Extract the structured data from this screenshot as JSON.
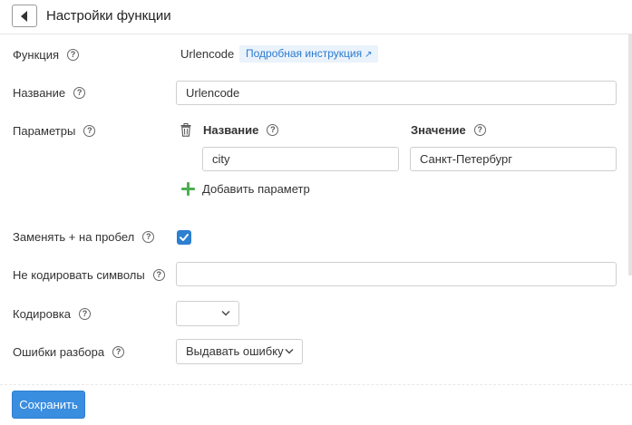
{
  "header": {
    "title": "Настройки функции",
    "back_icon": "caret-left-icon"
  },
  "form": {
    "function": {
      "label": "Функция",
      "value": "Urlencode",
      "link_label": "Подробная инструкция",
      "link_icon": "↗"
    },
    "name": {
      "label": "Название",
      "value": "Urlencode"
    },
    "params": {
      "label": "Параметры",
      "col_name": "Название",
      "col_value": "Значение",
      "rows": [
        {
          "name": "city",
          "value": "Санкт-Петербург"
        }
      ],
      "add_label": "Добавить параметр"
    },
    "replace_plus": {
      "label": "Заменять + на пробел",
      "checked": true
    },
    "no_encode": {
      "label": "Не кодировать символы",
      "value": ""
    },
    "encoding": {
      "label": "Кодировка",
      "value": ""
    },
    "parse_errors": {
      "label": "Ошибки разбора",
      "value": "Выдавать ошибку"
    },
    "help_glyph": "?"
  },
  "footer": {
    "save_label": "Сохранить"
  },
  "colors": {
    "accent": "#3a8ee0",
    "link": "#2b7bd0",
    "add_icon": "#4caf50",
    "checkbox": "#2d7fd0"
  }
}
